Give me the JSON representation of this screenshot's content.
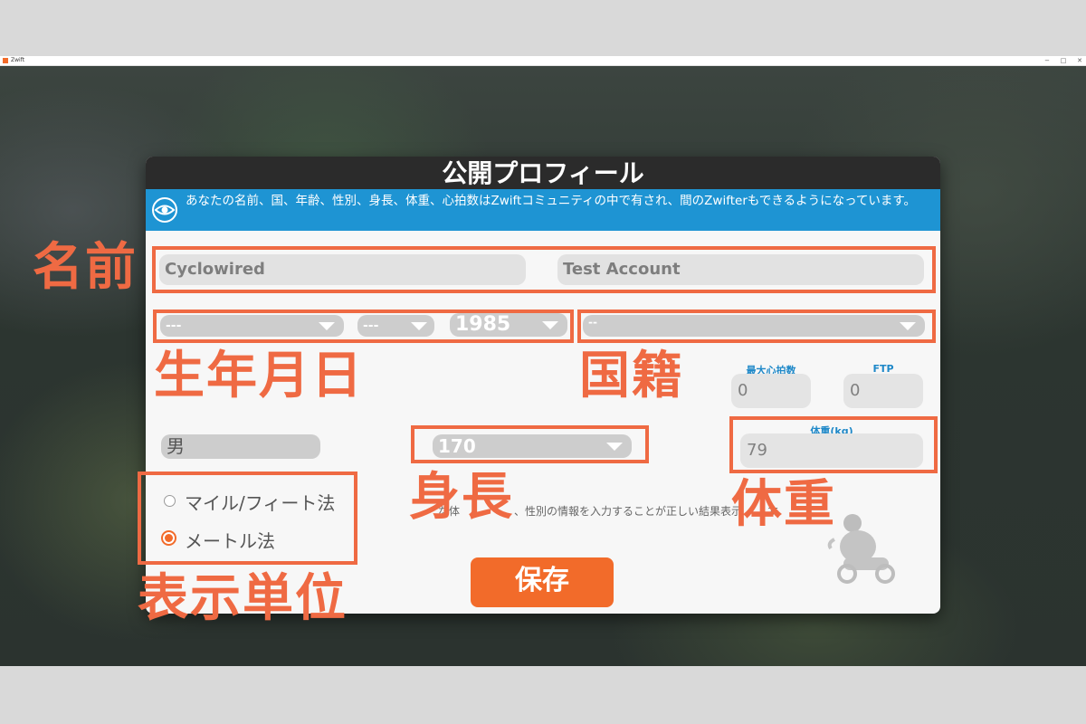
{
  "window": {
    "title": "Zwift",
    "minimize": "−",
    "maximize": "□",
    "close": "✕"
  },
  "dialog": {
    "title": "公開プロフィール",
    "notice": "あなたの名前、国、年齢、性別、身長、体重、心拍数はZwiftコミュニティの中で有され、間のZwifterもできるようになっています。",
    "first_name": "Cyclowired",
    "last_name": "Test Account",
    "birth_day": "---",
    "birth_month": "---",
    "birth_year": "1985",
    "country": "--",
    "max_hr_label": "最大心拍数",
    "max_hr": "0",
    "ftp_label": "FTP",
    "ftp": "0",
    "gender": "男",
    "height": "170",
    "weight_label": "体重(kg)",
    "weight": "79",
    "units": [
      {
        "label": "マイル/フィート法",
        "selected": false
      },
      {
        "label": "メートル法",
        "selected": true
      }
    ],
    "note_fragment_1": "な体",
    "note_fragment_2": "、性別の情報を入力することが正しい結果表示",
    "note_fragment_3": "す",
    "save_label": "保存"
  },
  "annotations": {
    "name": "名前",
    "birthday": "生年月日",
    "country": "国籍",
    "height": "身長",
    "weight": "体重",
    "units": "表示単位"
  },
  "colors": {
    "accent": "#f26b2a",
    "annotation": "#ef6a43",
    "banner": "#1e94d3"
  },
  "icons": [
    "eye-icon",
    "cyclist-mascot-icon",
    "caret-down-icon"
  ]
}
